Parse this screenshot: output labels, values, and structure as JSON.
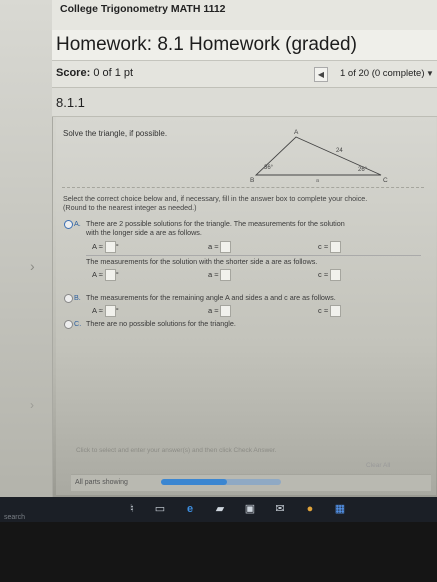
{
  "course": {
    "title": "College Trigonometry MATH 1112"
  },
  "homework": {
    "title": "Homework: 8.1 Homework (graded)"
  },
  "score": {
    "label": "Score:",
    "value": "0 of 1 pt"
  },
  "nav": {
    "position": "1 of 20 (0 complete)"
  },
  "question": {
    "number": "8.1.1",
    "prompt": "Solve the triangle, if possible.",
    "figure": {
      "A": "A",
      "B": "B",
      "C": "C",
      "side_c": "24",
      "side_a": "a",
      "angle_B": "36°",
      "angle_C": "26°"
    },
    "instructions": "Select the correct choice below and, if necessary, fill in the answer box to complete your choice.",
    "round_note": "(Round to the nearest integer as needed.)",
    "options": [
      {
        "letter": "A.",
        "text_1": "There are 2 possible solutions for the triangle. The measurements for the solution",
        "text_2": "with the longer side a are as follows.",
        "text_3": "The measurements for the solution with the shorter side a are as follows."
      },
      {
        "letter": "B.",
        "text_1": "The measurements for the remaining angle A and sides a and c are as follows."
      },
      {
        "letter": "C.",
        "text_1": "There are no possible solutions for the triangle."
      }
    ],
    "labels": {
      "A": "A ≈",
      "a": "a ≈",
      "c": "c ≈",
      "deg": "°"
    }
  },
  "footer": {
    "hint": "Click to select and enter your answer(s) and then click Check Answer.",
    "clear": "Clear All",
    "parts": "All parts showing",
    "progress": 0.55
  },
  "taskbar": {
    "search": "search"
  }
}
